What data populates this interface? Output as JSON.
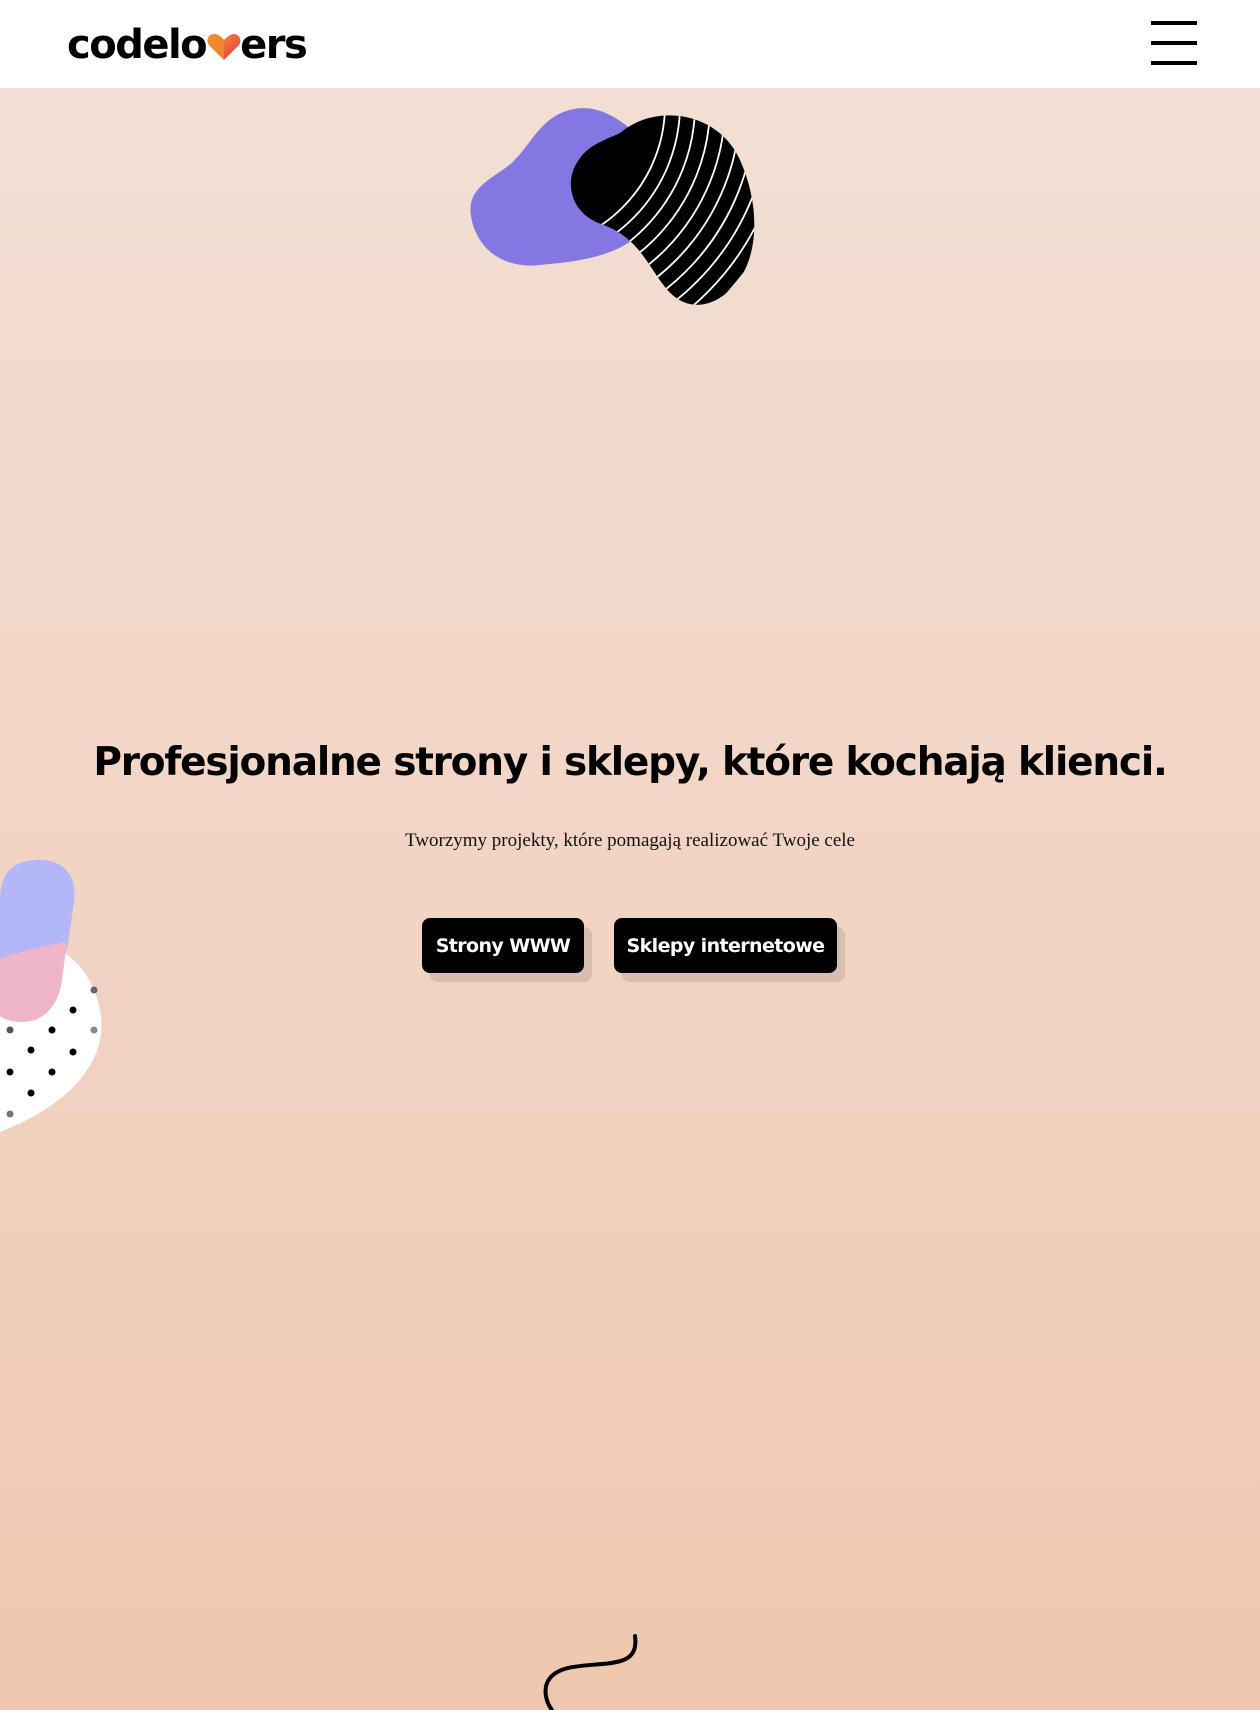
{
  "header": {
    "logo": {
      "text_before": "codelo",
      "text_after": "ers",
      "heart_icon": "heart-icon"
    },
    "menu_icon": "hamburger-menu-icon"
  },
  "hero": {
    "title": "Profesjonalne strony i sklepy, które kochają klienci.",
    "subtitle": "Tworzymy projekty, które pomagają realizować Twoje cele",
    "buttons": [
      {
        "label": "Strony WWW"
      },
      {
        "label": "Sklepy internetowe"
      }
    ]
  },
  "colors": {
    "background_top": "#f3e0d6",
    "background_bottom": "#efc7af",
    "purple_blob": "#8577e1",
    "lavender": "#b3b6f7",
    "pink": "#eeb6c8",
    "heart_orange": "#f08a2a",
    "heart_red": "#e6324b",
    "text": "#000000"
  }
}
